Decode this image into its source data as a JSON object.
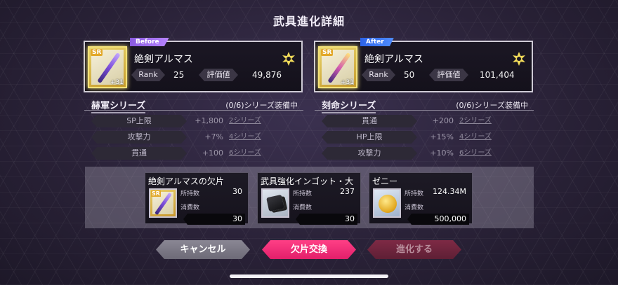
{
  "title": "武具進化詳細",
  "before": {
    "tag": "Before",
    "name": "絶剣アルマス",
    "rarity": "SR",
    "plus": "+31",
    "rank_label": "Rank",
    "rank": "25",
    "rating_label": "評価値",
    "rating": "49,876"
  },
  "after": {
    "tag": "After",
    "name": "絶剣アルマス",
    "rarity": "SR",
    "plus": "+31",
    "rank_label": "Rank",
    "rank": "50",
    "rating_label": "評価値",
    "rating": "101,404"
  },
  "series_left": {
    "name": "赫軍シリーズ",
    "count": "(0/6)シリーズ装備中",
    "rows": [
      {
        "label": "SP上限",
        "amount": "+1,800",
        "req": "2シリーズ"
      },
      {
        "label": "攻撃力",
        "amount": "+7%",
        "req": "4シリーズ"
      },
      {
        "label": "貫通",
        "amount": "+100",
        "req": "6シリーズ"
      }
    ]
  },
  "series_right": {
    "name": "刻命シリーズ",
    "count": "(0/6)シリーズ装備中",
    "rows": [
      {
        "label": "貫通",
        "amount": "+200",
        "req": "2シリーズ"
      },
      {
        "label": "HP上限",
        "amount": "+15%",
        "req": "4シリーズ"
      },
      {
        "label": "攻撃力",
        "amount": "+10%",
        "req": "6シリーズ"
      }
    ]
  },
  "materials": [
    {
      "name": "絶剣アルマスの欠片",
      "own_label": "所持数",
      "own": "30",
      "use_label": "消費数",
      "use": "30",
      "icon": "weapon-fragment-icon"
    },
    {
      "name": "武具強化インゴット・大",
      "own_label": "所持数",
      "own": "237",
      "use_label": "消費数",
      "use": "30",
      "icon": "ingot-icon"
    },
    {
      "name": "ゼニー",
      "own_label": "所持数",
      "own": "124.34M",
      "use_label": "消費数",
      "use": "500,000",
      "icon": "zeny-coin-icon"
    }
  ],
  "buttons": {
    "cancel": "キャンセル",
    "exchange": "欠片交換",
    "evolve": "進化する"
  },
  "colors": {
    "before_tag": "#9a6aee",
    "after_tag": "#3a74f2",
    "exchange_button": "#f02c77",
    "evolve_button_disabled": "#6e2540"
  }
}
